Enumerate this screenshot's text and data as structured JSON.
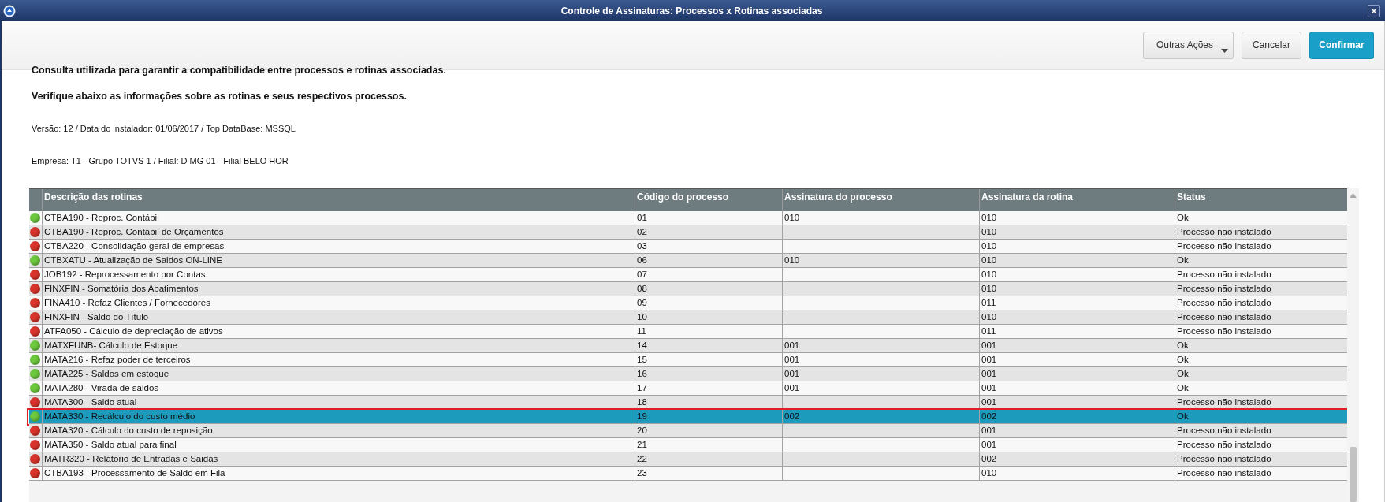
{
  "window": {
    "title": "Controle de Assinaturas: Processos x Rotinas associadas"
  },
  "actions": [
    {
      "label": "Outras Ações",
      "kind": "menu"
    },
    {
      "label": "Cancelar",
      "kind": "plain"
    },
    {
      "label": "Confirmar",
      "kind": "primary"
    }
  ],
  "intro": [
    {
      "text": "Consulta utilizada para garantir a compatibilidade entre processos e rotinas associadas.",
      "kind": "heading"
    },
    {
      "text": "Verifique abaixo as informações sobre as rotinas e seus respectivos processos.",
      "kind": "heading"
    },
    {
      "text": "Versão: 12 / Data do instalador: 01/06/2017 / Top DataBase: MSSQL",
      "kind": "info"
    },
    {
      "text": "Empresa: T1 - Grupo TOTVS 1 / Filial: D MG 01  - Filial BELO HOR",
      "kind": "info"
    }
  ],
  "table": {
    "columns": [
      "Descrição das rotinas",
      "Código do processo",
      "Assinatura do processo",
      "Assinatura da rotina",
      "Status"
    ],
    "rows": [
      {
        "color": "#6cc83c",
        "selected": false,
        "outlined": false,
        "description": "CTBA190 - Reproc. Contábil",
        "process_code": "01",
        "process_signature": "010",
        "routine_signature": "010",
        "status": "Ok"
      },
      {
        "color": "#d9342b",
        "selected": false,
        "outlined": false,
        "description": "CTBA190 - Reproc. Contábil de Orçamentos",
        "process_code": "02",
        "routine_signature": "010",
        "status": "Processo não instalado"
      },
      {
        "color": "#d9342b",
        "selected": false,
        "outlined": false,
        "description": "CTBA220 - Consolidação geral de empresas",
        "process_code": "03",
        "routine_signature": "010",
        "status": "Processo não instalado"
      },
      {
        "color": "#6cc83c",
        "selected": false,
        "outlined": false,
        "description": "CTBXATU - Atualização de Saldos ON-LINE",
        "process_code": "06",
        "process_signature": "010",
        "routine_signature": "010",
        "status": "Ok"
      },
      {
        "color": "#d9342b",
        "selected": false,
        "outlined": false,
        "description": "JOB192 - Reprocessamento por Contas",
        "process_code": "07",
        "routine_signature": "010",
        "status": "Processo não instalado"
      },
      {
        "color": "#d9342b",
        "selected": false,
        "outlined": false,
        "description": "FINXFIN - Somatória dos Abatimentos",
        "process_code": "08",
        "routine_signature": "010",
        "status": "Processo não instalado"
      },
      {
        "color": "#d9342b",
        "selected": false,
        "outlined": false,
        "description": "FINA410 - Refaz Clientes / Fornecedores",
        "process_code": "09",
        "routine_signature": "011",
        "status": "Processo não instalado"
      },
      {
        "color": "#d9342b",
        "selected": false,
        "outlined": false,
        "description": "FINXFIN - Saldo do Título",
        "process_code": "10",
        "routine_signature": "010",
        "status": "Processo não instalado"
      },
      {
        "color": "#d9342b",
        "selected": false,
        "outlined": false,
        "description": "ATFA050 - Cálculo de depreciação de ativos",
        "process_code": "11",
        "routine_signature": "011",
        "status": "Processo não instalado"
      },
      {
        "color": "#6cc83c",
        "selected": false,
        "outlined": false,
        "description": "MATXFUNB- Cálculo de Estoque",
        "process_code": "14",
        "process_signature": "001",
        "routine_signature": "001",
        "status": "Ok"
      },
      {
        "color": "#6cc83c",
        "selected": false,
        "outlined": false,
        "description": "MATA216 - Refaz poder de terceiros",
        "process_code": "15",
        "process_signature": "001",
        "routine_signature": "001",
        "status": "Ok"
      },
      {
        "color": "#6cc83c",
        "selected": false,
        "outlined": false,
        "description": "MATA225 - Saldos em estoque",
        "process_code": "16",
        "process_signature": "001",
        "routine_signature": "001",
        "status": "Ok"
      },
      {
        "color": "#6cc83c",
        "selected": false,
        "outlined": false,
        "description": "MATA280 - Virada de saldos",
        "process_code": "17",
        "process_signature": "001",
        "routine_signature": "001",
        "status": "Ok"
      },
      {
        "color": "#d9342b",
        "selected": false,
        "outlined": false,
        "description": "MATA300 - Saldo atual",
        "process_code": "18",
        "routine_signature": "001",
        "status": "Processo não instalado"
      },
      {
        "color": "#6cc83c",
        "selected": true,
        "outlined": true,
        "description": "MATA330 - Recálculo do custo médio",
        "process_code": "19",
        "process_signature": "002",
        "routine_signature": "002",
        "status": "Ok"
      },
      {
        "color": "#d9342b",
        "selected": false,
        "outlined": false,
        "description": "MATA320 - Cálculo do custo de reposição",
        "process_code": "20",
        "routine_signature": "001",
        "status": "Processo não instalado"
      },
      {
        "color": "#d9342b",
        "selected": false,
        "outlined": false,
        "description": "MATA350 - Saldo atual para final",
        "process_code": "21",
        "routine_signature": "001",
        "status": "Processo não instalado"
      },
      {
        "color": "#d9342b",
        "selected": false,
        "outlined": false,
        "description": "MATR320 - Relatorio de Entradas e Saidas",
        "process_code": "22",
        "routine_signature": "002",
        "status": "Processo não instalado"
      },
      {
        "color": "#d9342b",
        "selected": false,
        "outlined": false,
        "description": "CTBA193 - Processamento de Saldo em Fila",
        "process_code": "23",
        "routine_signature": "010",
        "status": "Processo não instalado"
      }
    ]
  }
}
